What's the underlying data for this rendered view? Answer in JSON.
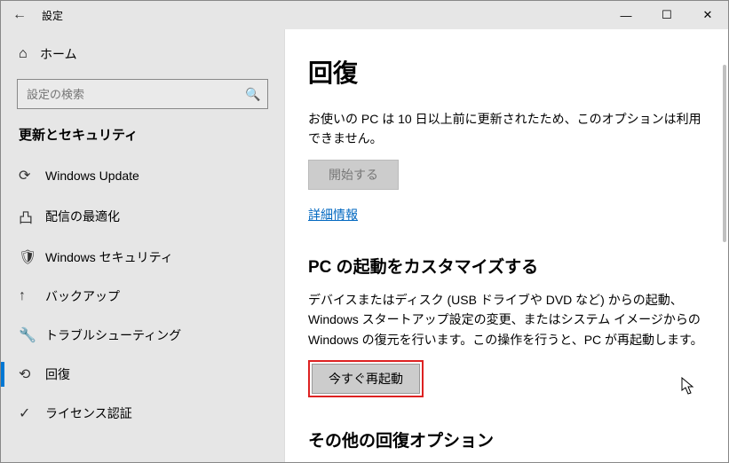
{
  "titlebar": {
    "title": "設定"
  },
  "sidebar": {
    "home": "ホーム",
    "search_placeholder": "設定の検索",
    "section": "更新とセキュリティ",
    "items": [
      {
        "icon": "⟳",
        "label": "Windows Update"
      },
      {
        "icon": "凸",
        "label": "配信の最適化"
      },
      {
        "icon": "🛡",
        "label": "Windows セキュリティ"
      },
      {
        "icon": "↑",
        "label": "バックアップ"
      },
      {
        "icon": "🔧",
        "label": "トラブルシューティング"
      },
      {
        "icon": "⟲",
        "label": "回復"
      },
      {
        "icon": "✓",
        "label": "ライセンス認証"
      }
    ]
  },
  "content": {
    "page_title": "回復",
    "p1": "お使いの PC は 10 日以上前に更新されたため、このオプションは利用できません。",
    "start_btn": "開始する",
    "more_info": "詳細情報",
    "sub1": "PC の起動をカスタマイズする",
    "p2": "デバイスまたはディスク (USB ドライブや DVD など) からの起動、Windows スタートアップ設定の変更、またはシステム イメージからの Windows の復元を行います。この操作を行うと、PC が再起動します。",
    "restart_btn": "今すぐ再起動",
    "sub2": "その他の回復オプション"
  }
}
